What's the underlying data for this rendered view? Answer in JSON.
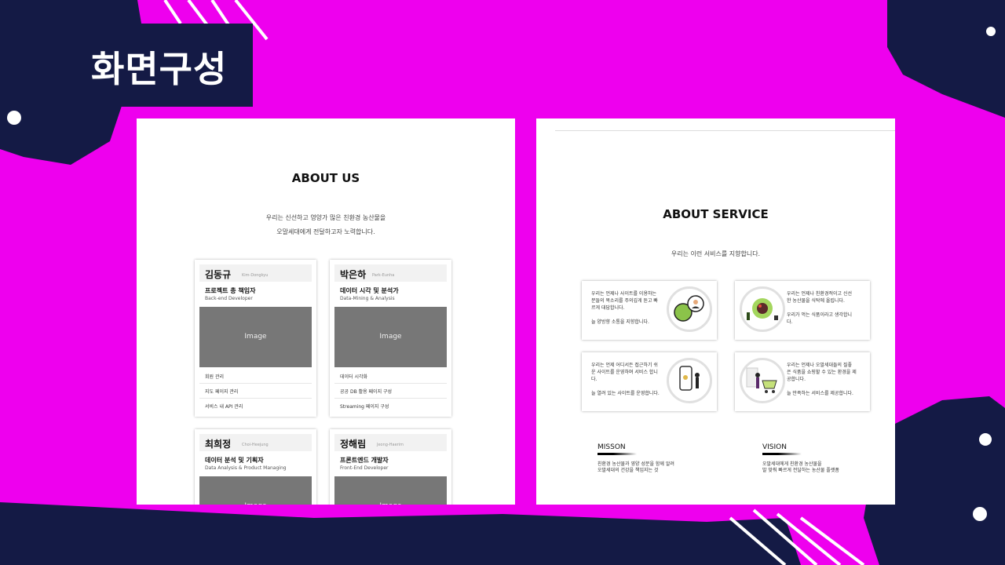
{
  "slide": {
    "title": "화면구성"
  },
  "about_us": {
    "title": "ABOUT US",
    "description_lines": [
      "우리는 신선하고 영양가 많은 친환경 농산물을",
      "오말세대에게 전달하고자 노력합니다."
    ],
    "members": [
      {
        "name": "김동규",
        "name_en": "Kim-Dongkyu",
        "role": "프로젝트 총 책임자",
        "role_en": "Back-end Developer",
        "image_label": "Image",
        "tasks": [
          "회원 관리",
          "지도 페이지 관리",
          "서비스 내 API 관리"
        ]
      },
      {
        "name": "박은하",
        "name_en": "Park-Eunha",
        "role": "데이터 시각 및 분석가",
        "role_en": "Data-Mining & Analysis",
        "image_label": "Image",
        "tasks": [
          "데이터 시각화",
          "공공 DB 활용 페이지 구성",
          "Streaming 페이지 구성"
        ]
      },
      {
        "name": "최희정",
        "name_en": "Choi-Heejung",
        "role": "데이터 분석 및 기획자",
        "role_en": "Data Analysis & Product Managing",
        "image_label": "Image",
        "tasks": []
      },
      {
        "name": "정해림",
        "name_en": "Jeong-Haerim",
        "role": "프론트엔드 개발자",
        "role_en": "Front-End Developer",
        "image_label": "Image",
        "tasks": []
      }
    ]
  },
  "about_service": {
    "title": "ABOUT SERVICE",
    "description": "우리는 이런 서비스를 지향합니다.",
    "cards": [
      {
        "text": "우리는 언제나 사이트를 이용하는\n분들의 목소리를 주의깊게 듣고 빠\n르게 대답합니다.\n\n늘 양방향 소통을 지향합니다.",
        "icon": "chat-bubbles-icon"
      },
      {
        "text": "우리는 언제나 친환경적이고 신선\n한 농산물을 식탁에 올립니다.\n\n우리가 먹는 식품이라고 생각합니\n다.",
        "icon": "salad-bowl-icon"
      },
      {
        "text": "우리는 언제 어디서든 접근하기 쉬\n운 사이트를 운영하며 서비스 합니\n다.\n\n늘 열려 있는 사이트를 운영합니다.",
        "icon": "mobile-phone-icon"
      },
      {
        "text": "우리는 언제나 오말세대들의 질좋\n은 식품을 쇼핑할 수 있는 환경을 제\n공합니다.\n\n늘 만족하는 서비스를 제공합니다.",
        "icon": "shopping-cart-icon"
      }
    ],
    "mission": {
      "title": "MISSON",
      "text": "친환경 농산물과 영양 성분을 함께 알려\n오말세대의 건강을 책임지는 것"
    },
    "vision": {
      "title": "VISION",
      "text": "오말세대에게 친환경 농산물을\n발 맞춰 빠르게 전달하는 농산물 플랫폼"
    }
  },
  "colors": {
    "background": "#ee00ee",
    "decoration": "#141a45",
    "card_image": "#777777"
  }
}
